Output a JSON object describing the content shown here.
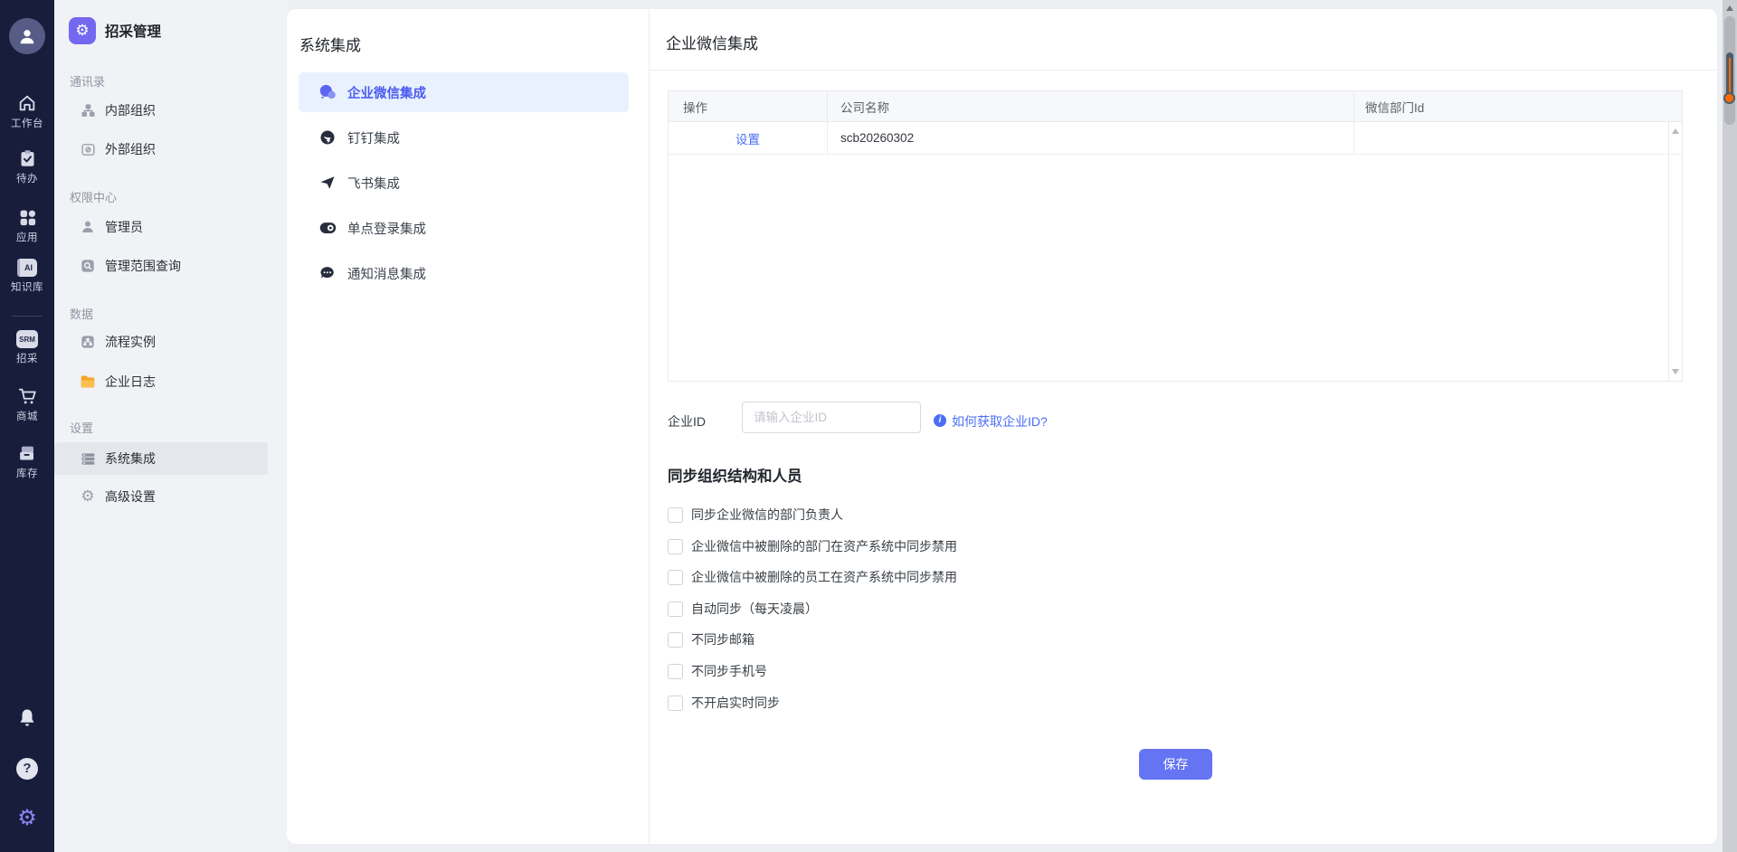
{
  "rail": {
    "items": [
      {
        "label": "工作台",
        "icon": "home-icon"
      },
      {
        "label": "待办",
        "icon": "todo-clipboard-icon"
      },
      {
        "label": "应用",
        "icon": "apps-grid-icon"
      },
      {
        "label": "知识库",
        "icon": "ai-knowledge-icon",
        "badge": "AI"
      },
      {
        "label": "招采",
        "icon": "srm-badge-icon",
        "badge": "SRM"
      },
      {
        "label": "商城",
        "icon": "cart-icon"
      },
      {
        "label": "库存",
        "icon": "inventory-icon"
      }
    ]
  },
  "sidebar": {
    "app_title": "招采管理",
    "sections": [
      {
        "label": "通讯录",
        "items": [
          {
            "label": "内部组织"
          },
          {
            "label": "外部组织"
          }
        ]
      },
      {
        "label": "权限中心",
        "items": [
          {
            "label": "管理员"
          },
          {
            "label": "管理范围查询"
          }
        ]
      },
      {
        "label": "数据",
        "items": [
          {
            "label": "流程实例"
          },
          {
            "label": "企业日志"
          }
        ]
      },
      {
        "label": "设置",
        "items": [
          {
            "label": "系统集成",
            "selected": true
          },
          {
            "label": "高级设置"
          }
        ]
      }
    ]
  },
  "integration_nav": {
    "title": "系统集成",
    "items": [
      {
        "label": "企业微信集成",
        "selected": true
      },
      {
        "label": "钉钉集成",
        "selected": false
      },
      {
        "label": "飞书集成",
        "selected": false
      },
      {
        "label": "单点登录集成",
        "selected": false
      },
      {
        "label": "通知消息集成",
        "selected": false
      }
    ]
  },
  "main": {
    "title": "企业微信集成",
    "table": {
      "columns": [
        "操作",
        "公司名称",
        "微信部门Id"
      ],
      "rows": [
        {
          "action": "设置",
          "company": "scb20260302",
          "wechat_dept_id": ""
        }
      ]
    },
    "corp_id": {
      "label": "企业ID",
      "placeholder": "请输入企业ID",
      "value": "",
      "help_link": "如何获取企业ID?"
    },
    "sync_section": {
      "title": "同步组织结构和人员",
      "options": [
        {
          "label": "同步企业微信的部门负责人",
          "checked": false
        },
        {
          "label": "企业微信中被删除的部门在资产系统中同步禁用",
          "checked": false
        },
        {
          "label": "企业微信中被删除的员工在资产系统中同步禁用",
          "checked": false
        },
        {
          "label": "自动同步（每天凌晨）",
          "checked": false
        },
        {
          "label": "不同步邮箱",
          "checked": false
        },
        {
          "label": "不同步手机号",
          "checked": false
        },
        {
          "label": "不开启实时同步",
          "checked": false
        }
      ]
    },
    "save_label": "保存"
  },
  "colors": {
    "rail_bg": "#191d3c",
    "accent_purple": "#7468f0",
    "primary_blue": "#4a6ef5",
    "selected_nav_blue": "#4c5bf0",
    "selected_nav_bg": "#e8f1fd",
    "save_button": "#6574f2",
    "folder_orange": "#f5a623",
    "thermometer_orange": "#ff6a00"
  }
}
